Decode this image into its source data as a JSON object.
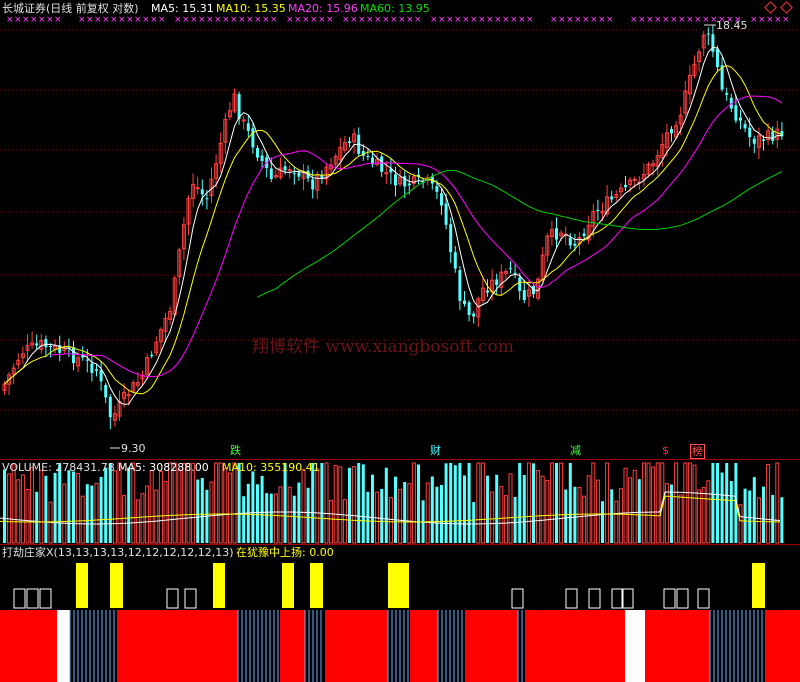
{
  "header": {
    "title": "长城证券(日线 前复权 对数)",
    "ma5": "MA5: 15.31",
    "ma10": "MA10: 15.35",
    "ma20": "MA20: 15.96",
    "ma60": "MA60: 13.95"
  },
  "price_panel": {
    "high_label": "18.45",
    "low_label": "9.30",
    "watermark": "翔博软件 www.xiangbosoft.com",
    "events": [
      "跌",
      "财",
      "减",
      "$",
      "榜"
    ]
  },
  "volume_panel": {
    "volume": "VOLUME: 278431.78",
    "ma5": "MA5: 308288.00",
    "ma10": "MA10: 355190.41"
  },
  "indicator_panel": {
    "name": "打劫庄家X(13,13,13,13,12,12,12,12,12,13)",
    "value": "在犹豫中上扬: 0.00"
  },
  "colors": {
    "up": "#ff4040",
    "down": "#55ffff",
    "ma5": "#ffffff",
    "ma10": "#ffff00",
    "ma20": "#ff00ff",
    "ma60": "#00d000",
    "indicator_red": "#ff0000",
    "indicator_yellow": "#ffff00"
  },
  "icons": [
    "diamond-icon",
    "marker-x-row"
  ]
}
